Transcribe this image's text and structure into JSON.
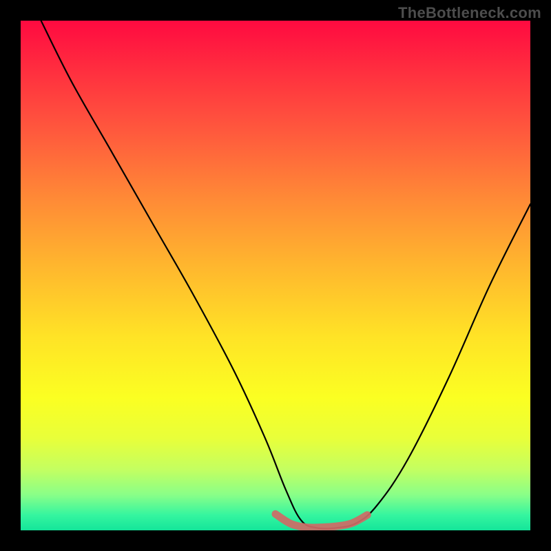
{
  "watermark": {
    "text": "TheBottleneck.com"
  },
  "chart_data": {
    "type": "line",
    "title": "",
    "xlabel": "",
    "ylabel": "",
    "xlim": [
      0,
      100
    ],
    "ylim": [
      0,
      100
    ],
    "series": [
      {
        "name": "curve",
        "color": "#000000",
        "x": [
          4,
          10,
          18,
          26,
          34,
          42,
          48,
          52,
          55,
          58,
          62,
          66,
          70,
          76,
          84,
          92,
          100
        ],
        "y": [
          100,
          88,
          74,
          60,
          46,
          31,
          18,
          8,
          2,
          0.5,
          0.5,
          1.5,
          5,
          14,
          30,
          48,
          64
        ]
      },
      {
        "name": "highlight-band",
        "color": "#cf6a66",
        "x": [
          50,
          53,
          56,
          59,
          62,
          65,
          68
        ],
        "y": [
          3.2,
          1.3,
          0.6,
          0.6,
          0.8,
          1.4,
          3.0
        ]
      }
    ],
    "background_gradient": {
      "direction": "vertical",
      "stops": [
        {
          "pos": 0.0,
          "color": "#ff0a40"
        },
        {
          "pos": 0.35,
          "color": "#ff8a36"
        },
        {
          "pos": 0.62,
          "color": "#ffe326"
        },
        {
          "pos": 0.88,
          "color": "#c4ff60"
        },
        {
          "pos": 1.0,
          "color": "#14e59a"
        }
      ]
    }
  }
}
